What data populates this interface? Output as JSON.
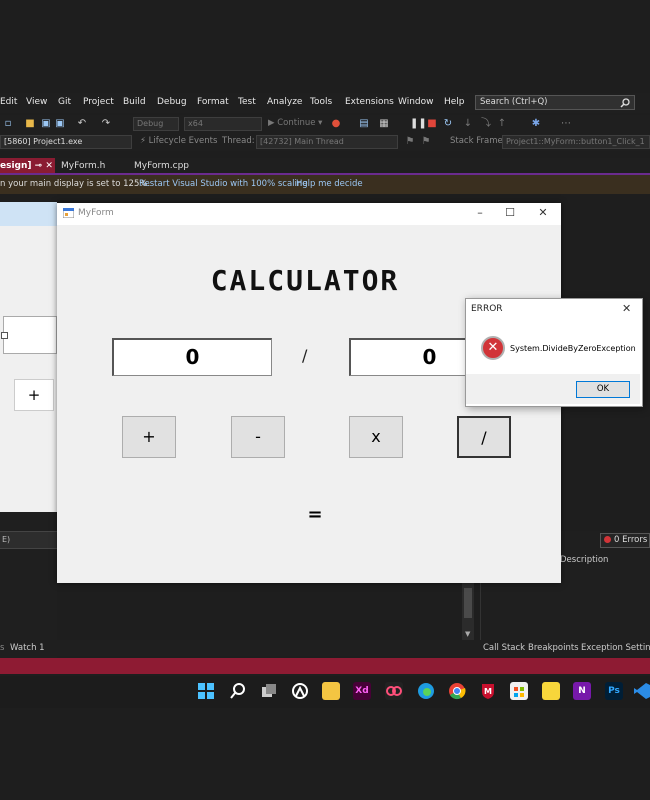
{
  "vs": {
    "menu": [
      "Edit",
      "View",
      "Git",
      "Project",
      "Build",
      "Debug",
      "Format",
      "Test",
      "Analyze",
      "Tools",
      "Extensions",
      "Window",
      "Help"
    ],
    "search_placeholder": "Search (Ctrl+Q)",
    "toolbar1": {
      "config": "Debug",
      "platform": "x64",
      "continue": "Continue"
    },
    "toolbar2": {
      "process": "[5860] Project1.exe",
      "lifecycle": "Lifecycle Events",
      "thread_label": "Thread:",
      "thread": "[42732] Main Thread",
      "stack_label": "Stack Frame:",
      "stack": "Project1::MyForm::button1_Click_1"
    },
    "tabs": {
      "active": "esign]",
      "tab2": "MyForm.h",
      "tab3": "MyForm.cpp"
    },
    "infobar": {
      "message": "n your main display is set to 125%.",
      "link1": "Restart Visual Studio with 100% scaling",
      "link2": "Help me decide"
    },
    "lower": {
      "left_field": "E)",
      "errors": "0 Errors",
      "description": "Description",
      "watch": "Watch 1",
      "call_stack": "Call Stack",
      "breakpoints": "Breakpoints",
      "exception_settings": "Exception Settings"
    },
    "designer_plus": "+"
  },
  "form": {
    "title": "MyForm",
    "heading": "CALCULATOR",
    "num1": "0",
    "operator": "/",
    "num2": "0",
    "buttons": {
      "add": "+",
      "subtract": "-",
      "multiply": "x",
      "divide": "/"
    },
    "equals": "="
  },
  "dialog": {
    "title": "ERROR",
    "message": "System.DivideByZeroException",
    "ok": "OK"
  },
  "taskbar": {
    "icons": [
      "windows-start-icon",
      "search-icon",
      "task-view-icon",
      "widgets-icon",
      "file-explorer-icon",
      "adobe-xd-icon",
      "creative-cloud-icon",
      "edge-icon",
      "chrome-icon",
      "mcafee-icon",
      "store-icon",
      "sticky-notes-icon",
      "onenote-icon",
      "photoshop-icon",
      "vs-code-icon"
    ],
    "xd_label": "Xd",
    "onenote_label": "N",
    "ps_label": "Ps"
  },
  "colors": {
    "accent_purple": "#6b2b8e",
    "status_bar": "#8e1b33",
    "error_red": "#d13438"
  }
}
